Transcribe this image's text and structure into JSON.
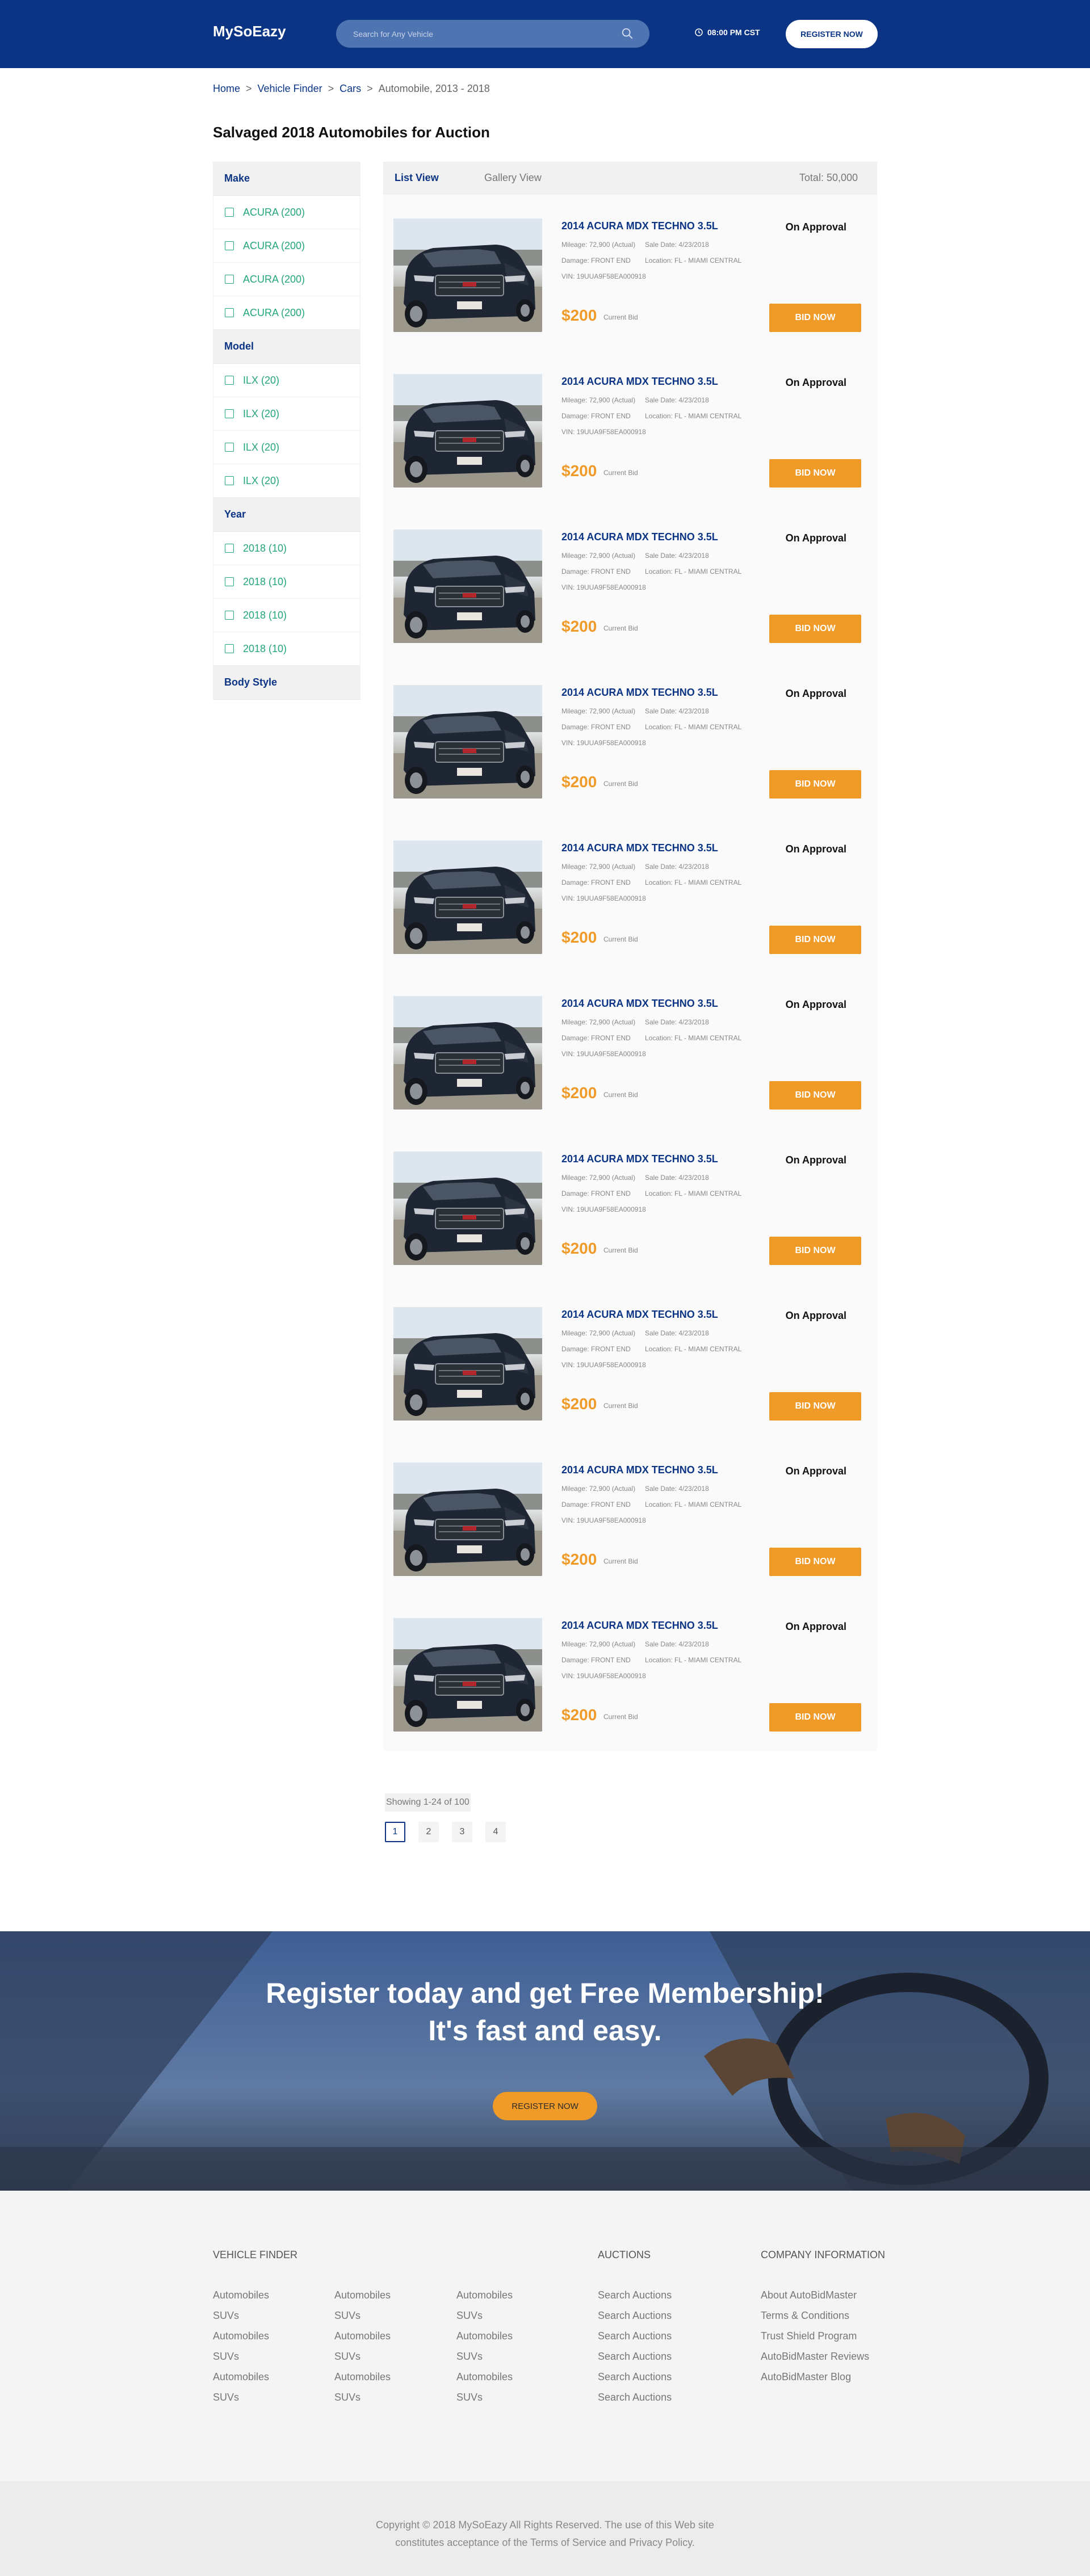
{
  "header": {
    "logo": "MySoEazy",
    "search_placeholder": "Search for Any Vehicle",
    "time": "08:00 PM CST",
    "register": "REGISTER NOW"
  },
  "breadcrumb": {
    "home": "Home",
    "vehicle_finder": "Vehicle Finder",
    "cars": "Cars",
    "current": "Automobile, 2013 - 2018",
    "sep": ">"
  },
  "page_title": "Salvaged 2018 Automobiles for Auction",
  "sidebar": {
    "make": {
      "title": "Make",
      "items": [
        "ACURA (200)",
        "ACURA (200)",
        "ACURA (200)",
        "ACURA (200)"
      ]
    },
    "model": {
      "title": "Model",
      "items": [
        "ILX (20)",
        "ILX (20)",
        "ILX (20)",
        "ILX (20)"
      ]
    },
    "year": {
      "title": "Year",
      "items": [
        "2018 (10)",
        "2018 (10)",
        "2018 (10)",
        "2018 (10)"
      ]
    },
    "body_style": {
      "title": "Body Style"
    }
  },
  "listing": {
    "list_view": "List View",
    "gallery_view": "Gallery View",
    "total": "Total: 50,000",
    "cards": [
      {
        "title": "2014 ACURA MDX TECHNO 3.5L",
        "mileage": "Mileage: 72,900 (Actual)",
        "sale_date": "Sale Date: 4/23/2018",
        "damage": "Damage: FRONT END",
        "location": "Location: FL - MIAMI CENTRAL",
        "vin": "VIN: 19UUA9F58EA000918",
        "status": "On Approval",
        "price": "$200",
        "price_label": "Current Bid",
        "bid": "BID NOW"
      },
      {
        "title": "2014 ACURA MDX TECHNO 3.5L",
        "mileage": "Mileage: 72,900 (Actual)",
        "sale_date": "Sale Date: 4/23/2018",
        "damage": "Damage: FRONT END",
        "location": "Location: FL - MIAMI CENTRAL",
        "vin": "VIN: 19UUA9F58EA000918",
        "status": "On Approval",
        "price": "$200",
        "price_label": "Current Bid",
        "bid": "BID NOW"
      },
      {
        "title": "2014 ACURA MDX TECHNO 3.5L",
        "mileage": "Mileage: 72,900 (Actual)",
        "sale_date": "Sale Date: 4/23/2018",
        "damage": "Damage: FRONT END",
        "location": "Location: FL - MIAMI CENTRAL",
        "vin": "VIN: 19UUA9F58EA000918",
        "status": "On Approval",
        "price": "$200",
        "price_label": "Current Bid",
        "bid": "BID NOW"
      },
      {
        "title": "2014 ACURA MDX TECHNO 3.5L",
        "mileage": "Mileage: 72,900 (Actual)",
        "sale_date": "Sale Date: 4/23/2018",
        "damage": "Damage: FRONT END",
        "location": "Location: FL - MIAMI CENTRAL",
        "vin": "VIN: 19UUA9F58EA000918",
        "status": "On Approval",
        "price": "$200",
        "price_label": "Current Bid",
        "bid": "BID NOW"
      },
      {
        "title": "2014 ACURA MDX TECHNO 3.5L",
        "mileage": "Mileage: 72,900 (Actual)",
        "sale_date": "Sale Date: 4/23/2018",
        "damage": "Damage: FRONT END",
        "location": "Location: FL - MIAMI CENTRAL",
        "vin": "VIN: 19UUA9F58EA000918",
        "status": "On Approval",
        "price": "$200",
        "price_label": "Current Bid",
        "bid": "BID NOW"
      },
      {
        "title": "2014 ACURA MDX TECHNO 3.5L",
        "mileage": "Mileage: 72,900 (Actual)",
        "sale_date": "Sale Date: 4/23/2018",
        "damage": "Damage: FRONT END",
        "location": "Location: FL - MIAMI CENTRAL",
        "vin": "VIN: 19UUA9F58EA000918",
        "status": "On Approval",
        "price": "$200",
        "price_label": "Current Bid",
        "bid": "BID NOW"
      },
      {
        "title": "2014 ACURA MDX TECHNO 3.5L",
        "mileage": "Mileage: 72,900 (Actual)",
        "sale_date": "Sale Date: 4/23/2018",
        "damage": "Damage: FRONT END",
        "location": "Location: FL - MIAMI CENTRAL",
        "vin": "VIN: 19UUA9F58EA000918",
        "status": "On Approval",
        "price": "$200",
        "price_label": "Current Bid",
        "bid": "BID NOW"
      },
      {
        "title": "2014 ACURA MDX TECHNO 3.5L",
        "mileage": "Mileage: 72,900 (Actual)",
        "sale_date": "Sale Date: 4/23/2018",
        "damage": "Damage: FRONT END",
        "location": "Location: FL - MIAMI CENTRAL",
        "vin": "VIN: 19UUA9F58EA000918",
        "status": "On Approval",
        "price": "$200",
        "price_label": "Current Bid",
        "bid": "BID NOW"
      },
      {
        "title": "2014 ACURA MDX TECHNO 3.5L",
        "mileage": "Mileage: 72,900 (Actual)",
        "sale_date": "Sale Date: 4/23/2018",
        "damage": "Damage: FRONT END",
        "location": "Location: FL - MIAMI CENTRAL",
        "vin": "VIN: 19UUA9F58EA000918",
        "status": "On Approval",
        "price": "$200",
        "price_label": "Current Bid",
        "bid": "BID NOW"
      },
      {
        "title": "2014 ACURA MDX TECHNO 3.5L",
        "mileage": "Mileage: 72,900 (Actual)",
        "sale_date": "Sale Date: 4/23/2018",
        "damage": "Damage: FRONT END",
        "location": "Location: FL - MIAMI CENTRAL",
        "vin": "VIN: 19UUA9F58EA000918",
        "status": "On Approval",
        "price": "$200",
        "price_label": "Current Bid",
        "bid": "BID NOW"
      }
    ]
  },
  "pagination": {
    "showing": "Showing 1-24 of 100",
    "pages": [
      "1",
      "2",
      "3",
      "4"
    ]
  },
  "banner": {
    "line1": "Register today and get Free Membership!",
    "line2": "It's fast and easy.",
    "button": "REGISTER NOW"
  },
  "footer": {
    "vehicle_finder_title": "VEHICLE FINDER",
    "vehicle_col1": [
      "Automobiles",
      "SUVs",
      "Automobiles",
      "SUVs",
      "Automobiles",
      "SUVs"
    ],
    "vehicle_col2": [
      "Automobiles",
      "SUVs",
      "Automobiles",
      "SUVs",
      "Automobiles",
      "SUVs"
    ],
    "vehicle_col3": [
      "Automobiles",
      "SUVs",
      "Automobiles",
      "SUVs",
      "Automobiles",
      "SUVs"
    ],
    "auctions_title": "AUCTIONS",
    "auctions": [
      "Search Auctions",
      "Search Auctions",
      "Search Auctions",
      "Search Auctions",
      "Search Auctions",
      "Search Auctions"
    ],
    "company_title": "COMPANY INFORMATION",
    "company": [
      "About AutoBidMaster",
      "Terms & Conditions",
      "Trust Shield Program",
      "AutoBidMaster Reviews",
      "AutoBidMaster Blog"
    ],
    "copyright_line1": "Copyright © 2018  MySoEazy All Rights Reserved. The use of this Web site",
    "copyright_line2": "constitutes acceptance of the Terms of Service and Privacy Policy."
  },
  "colors": {
    "brand_blue": "#0b3584",
    "accent_orange": "#f09a27",
    "filter_green": "#23a679"
  }
}
